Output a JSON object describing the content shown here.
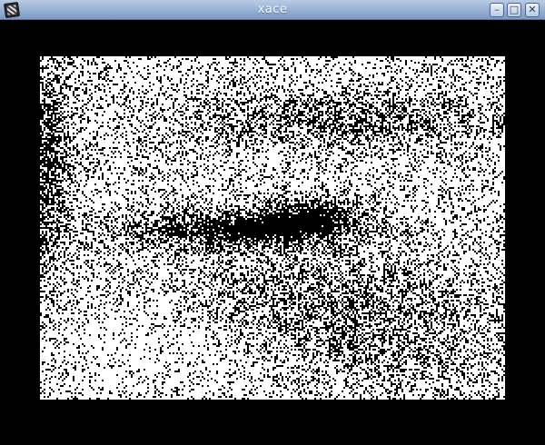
{
  "window": {
    "title": "xace",
    "minimize_symbol": "–",
    "maximize_symbol": "□",
    "close_symbol": "✕"
  },
  "icons": {
    "app": "app-icon",
    "minimize": "minimize-icon",
    "maximize": "maximize-icon",
    "close": "close-icon"
  },
  "colors": {
    "titlebar": "#9cb4d8",
    "border": "#000000",
    "screen_ink": "#000000",
    "screen_paper": "#ffffff"
  }
}
